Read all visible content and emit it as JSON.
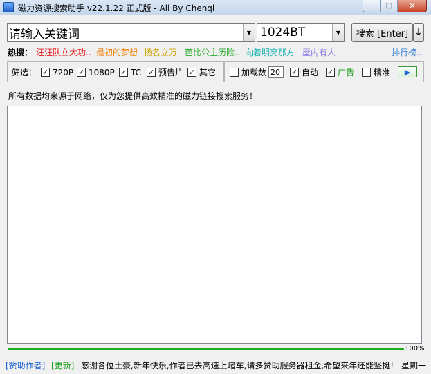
{
  "window": {
    "title": "磁力资源搜索助手 v22.1.22 正式版 - All By Chenql",
    "minimize_symbol": "—",
    "maximize_symbol": "□",
    "close_symbol": "✕"
  },
  "search": {
    "value": "请输入关键词",
    "arrow_symbol": "▼"
  },
  "engine": {
    "selected": "1024BT",
    "arrow_symbol": "▼"
  },
  "buttons": {
    "search_label": "搜索 [Enter]",
    "download_symbol": "↓",
    "play_symbol": "▶"
  },
  "hot": {
    "label": "热搜：",
    "items": [
      {
        "text": "汪汪队立大功..",
        "color": "#e81a1a"
      },
      {
        "text": "最初的梦想",
        "color": "#f07c00"
      },
      {
        "text": "扬名立万",
        "color": "#c9a400"
      },
      {
        "text": "芭比公主历险..",
        "color": "#2aa82a"
      },
      {
        "text": "向着明亮那方",
        "color": "#1fb5b5"
      },
      {
        "text": "屋内有人",
        "color": "#8c7be6"
      }
    ],
    "rank_link": "排行榜..."
  },
  "filter": {
    "label": "筛选：",
    "options": [
      {
        "label": "720P",
        "checked": true
      },
      {
        "label": "1080P",
        "checked": true
      },
      {
        "label": "TC",
        "checked": true
      },
      {
        "label": "预告片",
        "checked": true
      },
      {
        "label": "其它",
        "checked": true
      }
    ],
    "load_count_label": "加载数",
    "load_count_checked": false,
    "load_count_value": "20",
    "auto_label": "自动",
    "auto_checked": true,
    "ads_label": "广告",
    "ads_checked": true,
    "ads_color": "#1a9a1a",
    "precise_label": "精准",
    "precise_checked": false
  },
  "notice": "所有数据均来源于网络，仅为您提供高效精准的磁力链接搜索服务！",
  "progress": {
    "percent": 100,
    "text": "100%",
    "color": "#1db01d"
  },
  "status": {
    "sponsor": "[赞助作者]",
    "update": "[更新]",
    "message": "感谢各位土豪,新年快乐,作者已去高速上堵车,请多赞助服务器租金,希望来年还能坚挺!",
    "weekday": "星期一",
    "sponsor_color": "#1a5fd0",
    "update_color": "#1a9a1a"
  },
  "check_symbol": "✓"
}
